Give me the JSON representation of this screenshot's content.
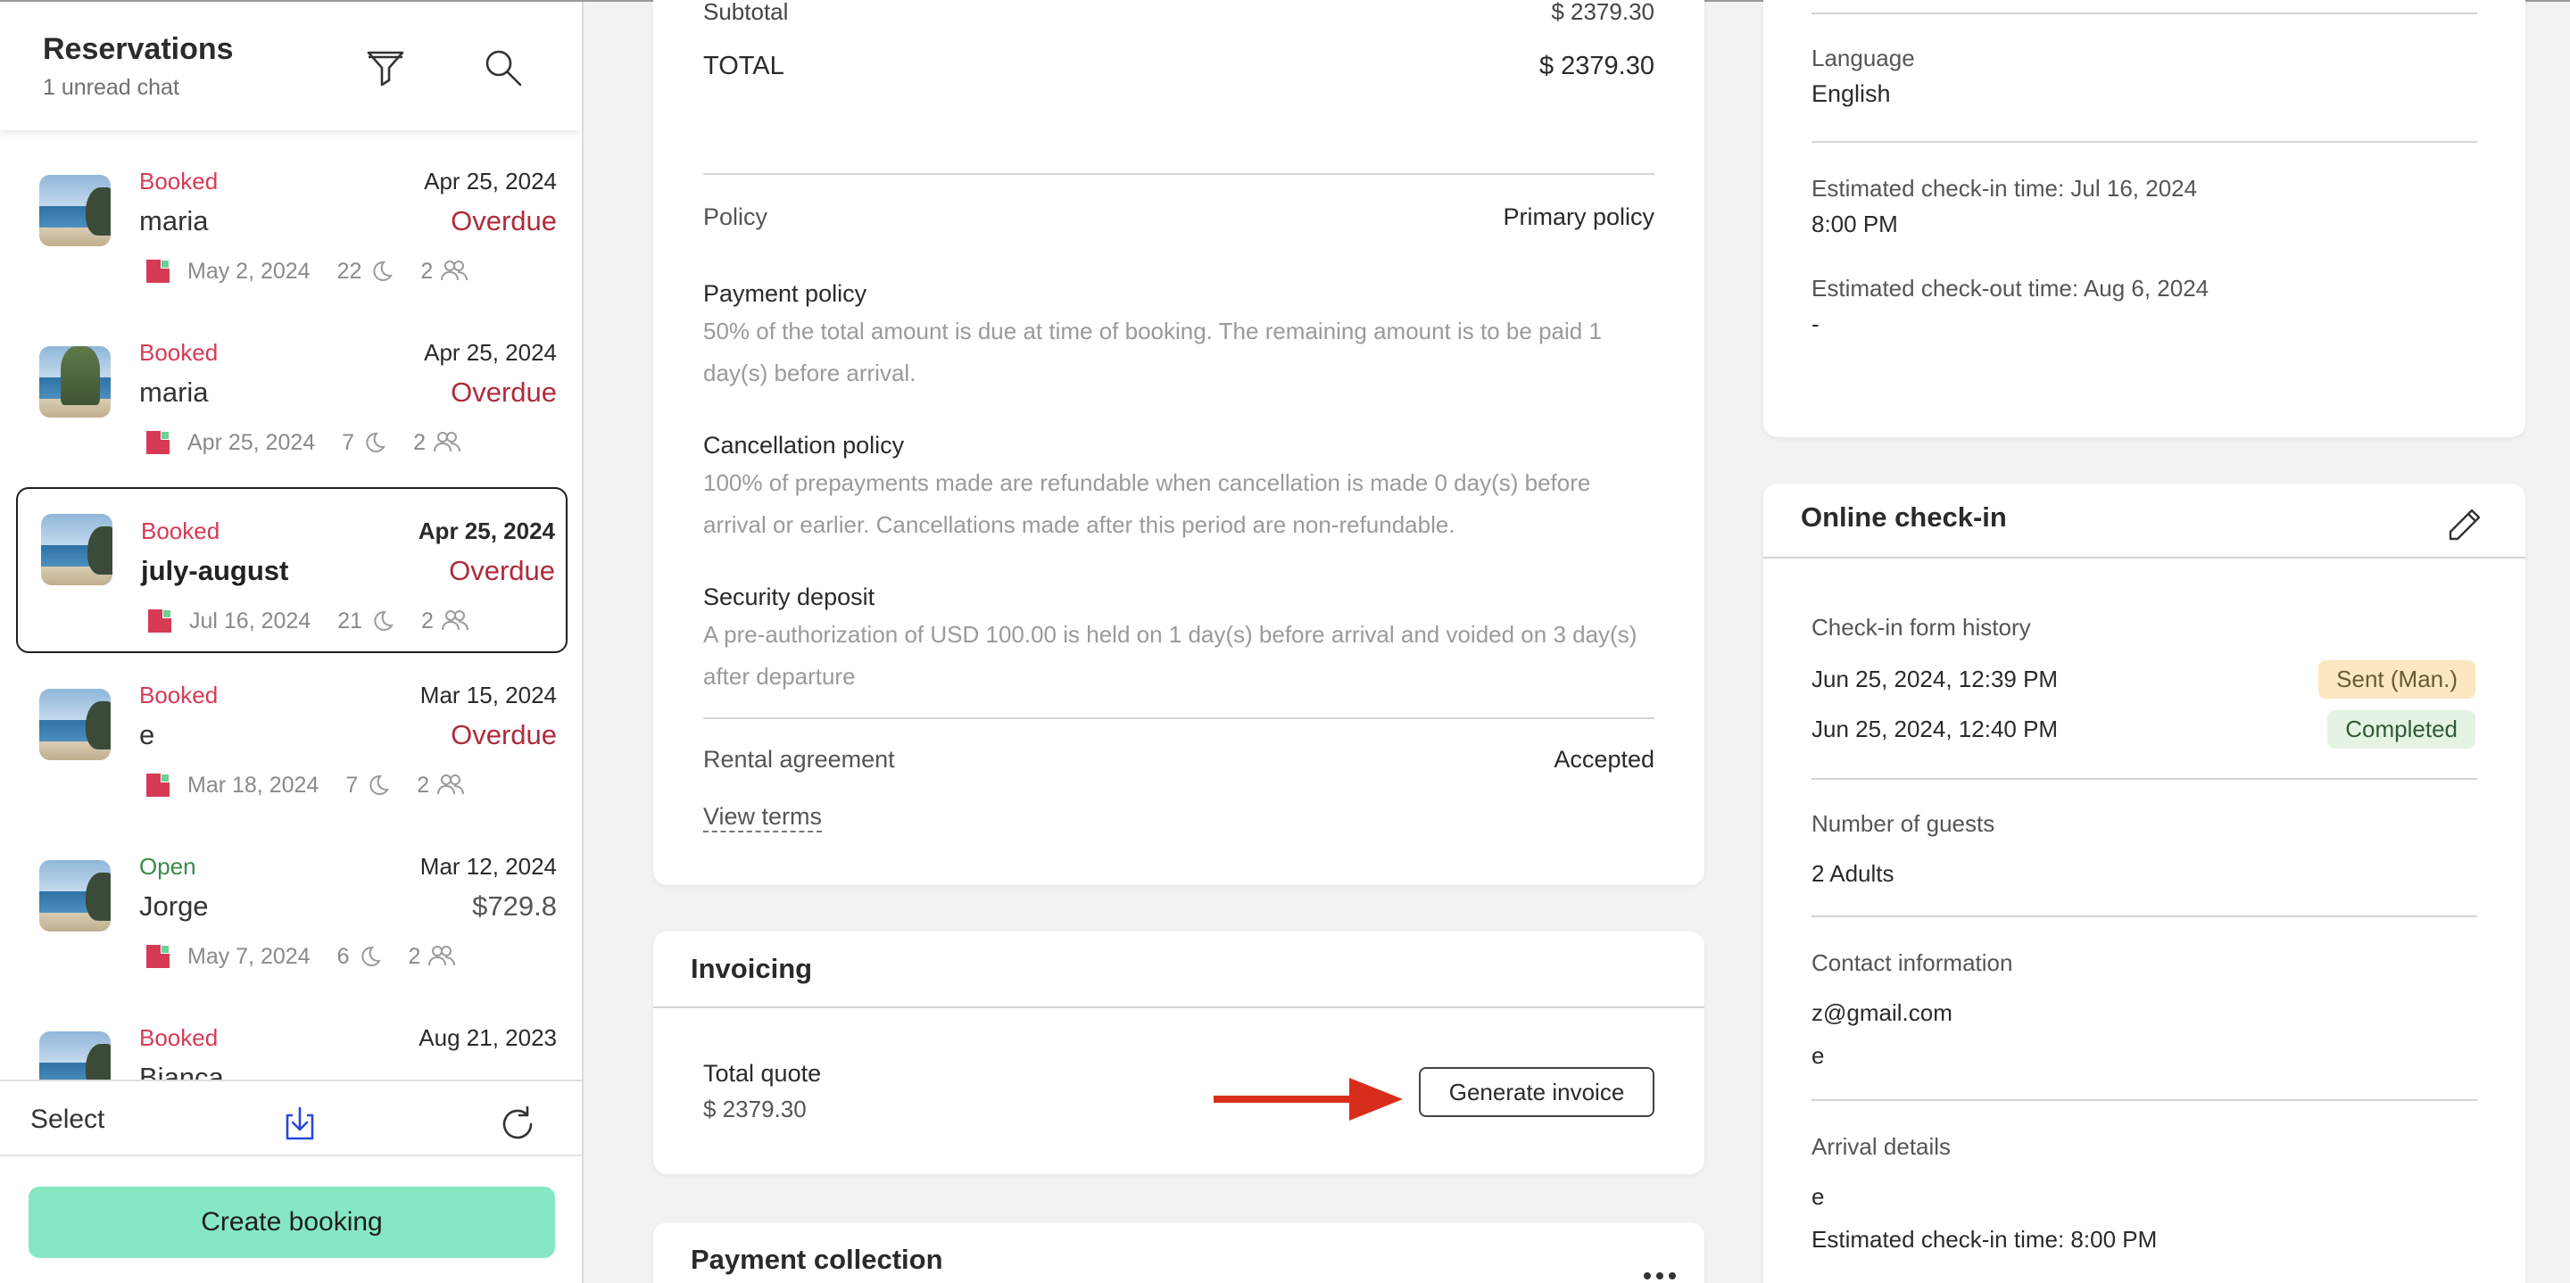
{
  "sidebar": {
    "title": "Reservations",
    "subtitle": "1 unread chat",
    "items": [
      {
        "status": "Booked",
        "date": "Apr 25, 2024",
        "guest": "maria",
        "right": "Overdue",
        "checkin": "May 2, 2024",
        "nights": "22",
        "guests": "2"
      },
      {
        "status": "Booked",
        "date": "Apr 25, 2024",
        "guest": "maria",
        "right": "Overdue",
        "checkin": "Apr 25, 2024",
        "nights": "7",
        "guests": "2"
      },
      {
        "status": "Booked",
        "date": "Apr 25, 2024",
        "guest": "july-august",
        "right": "Overdue",
        "checkin": "Jul 16, 2024",
        "nights": "21",
        "guests": "2"
      },
      {
        "status": "Booked",
        "date": "Mar 15, 2024",
        "guest": "e",
        "right": "Overdue",
        "checkin": "Mar 18, 2024",
        "nights": "7",
        "guests": "2"
      },
      {
        "status": "Open",
        "date": "Mar 12, 2024",
        "guest": "Jorge",
        "right": "$729.8",
        "checkin": "May 7, 2024",
        "nights": "6",
        "guests": "2"
      },
      {
        "status": "Booked",
        "date": "Aug 21, 2023",
        "guest": "Bianca",
        "right": "",
        "checkin": "",
        "nights": "",
        "guests": ""
      }
    ],
    "footer": {
      "select_label": "Select",
      "create_label": "Create booking"
    }
  },
  "quote": {
    "subtotal_label": "Subtotal",
    "subtotal_value": "$ 2379.30",
    "total_label": "TOTAL",
    "total_value": "$ 2379.30",
    "policy_label": "Policy",
    "policy_value": "Primary policy",
    "payment_title": "Payment policy",
    "payment_text": "50% of the total amount is due at time of booking. The remaining amount is to be paid 1 day(s) before arrival.",
    "cancel_title": "Cancellation policy",
    "cancel_text": "100% of prepayments made are refundable when cancellation is made 0 day(s) before arrival or earlier. Cancellations made after this period are non-refundable.",
    "deposit_title": "Security deposit",
    "deposit_text": "A pre-authorization of USD 100.00 is held on 1 day(s) before arrival and voided on 3 day(s) after departure",
    "rental_label": "Rental agreement",
    "rental_value": "Accepted",
    "terms_link": "View terms"
  },
  "invoicing": {
    "title": "Invoicing",
    "total_quote_label": "Total quote",
    "total_quote_value": "$ 2379.30",
    "generate_label": "Generate invoice"
  },
  "payment_collection": {
    "title": "Payment collection"
  },
  "guest_info": {
    "language_label": "Language",
    "language_value": "English",
    "checkin_label": "Estimated check-in time: Jul 16, 2024",
    "checkin_value": "8:00 PM",
    "checkout_label": "Estimated check-out time: Aug 6, 2024",
    "checkout_value": "-"
  },
  "online_checkin": {
    "title": "Online check-in",
    "history_label": "Check-in form history",
    "history": [
      {
        "time": "Jun 25, 2024, 12:39 PM",
        "badge": "Sent (Man.)"
      },
      {
        "time": "Jun 25, 2024, 12:40 PM",
        "badge": "Completed"
      }
    ],
    "guests_label": "Number of guests",
    "guests_value": "2 Adults",
    "contact_label": "Contact information",
    "contact_email": "z@gmail.com",
    "contact_extra": "e",
    "arrival_label": "Arrival details",
    "arrival_value": "e",
    "arrival_time": "Estimated check-in time: 8:00 PM"
  },
  "colors": {
    "booked": "#d63a55",
    "open": "#3a8a4a",
    "overdue": "#b02a3c",
    "create_button": "#86e8c2",
    "arrow": "#d92d1c"
  }
}
